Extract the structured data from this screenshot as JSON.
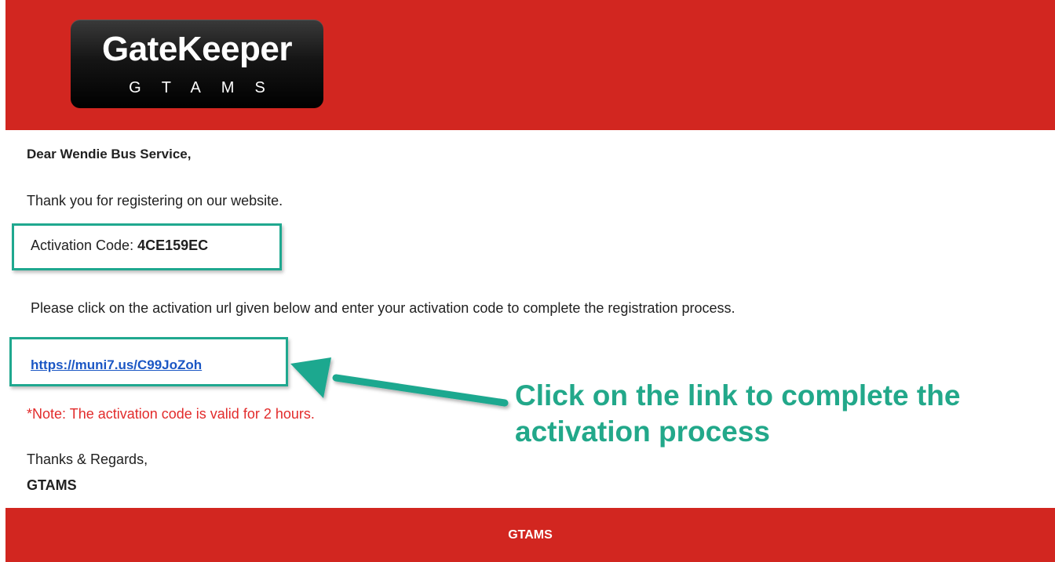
{
  "header": {
    "logo_title": "GateKeeper",
    "logo_subtitle": "GTAMS"
  },
  "email": {
    "greeting": "Dear Wendie Bus Service,",
    "thanks_line": "Thank you for registering on our website.",
    "activation_label": "Activation Code: ",
    "activation_code": "4CE159EC",
    "instruction": "Please click on the activation url given below and enter your activation code to complete the registration process.",
    "activation_url": "https://muni7.us/C99JoZoh",
    "note": "*Note: The activation code is valid for 2 hours.",
    "regards": "Thanks & Regards,",
    "signature": "GTAMS"
  },
  "annotation": {
    "callout_line1": "Click on the link to complete the",
    "callout_line2": "activation process"
  },
  "footer": {
    "text": "GTAMS"
  },
  "colors": {
    "brand_red": "#d22620",
    "highlight_teal": "#1fa88f",
    "callout_green": "#22a88a",
    "link_blue": "#1a56c4",
    "note_red": "#e22b2b"
  }
}
